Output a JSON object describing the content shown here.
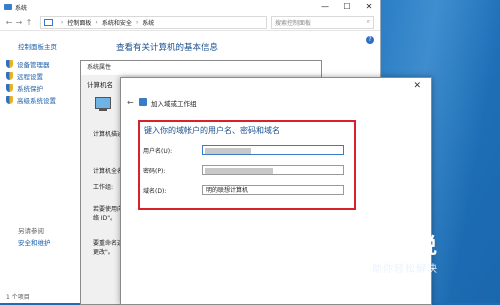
{
  "system_window": {
    "title": "系统",
    "controls": {
      "minimize": "—",
      "maximize": "☐",
      "close": "✕"
    },
    "breadcrumb": [
      "控制面板",
      "系统和安全",
      "系统"
    ],
    "search_placeholder": "搜索控制面板",
    "left_nav": {
      "home": "控制面板主页",
      "items": [
        "设备管理器",
        "远程设置",
        "系统保护",
        "高级系统设置"
      ],
      "see_also": "另请参阅",
      "security": "安全和维护"
    },
    "heading": "查看有关计算机的基本信息",
    "status": "1 个项目"
  },
  "properties_window": {
    "title": "系统属性",
    "tab": "计算机名",
    "labels": [
      "计算机描述",
      "计算机全名",
      "工作组:",
      "若要使用向导",
      "络 ID\"。",
      "要重命名这台",
      "更改\"。"
    ]
  },
  "dialog": {
    "title": "加入域或工作组",
    "close": "✕",
    "back": "←",
    "prompt": "键入你的域帐户的用户名、密码和域名",
    "fields": [
      {
        "label": "用户名(U):",
        "value": ""
      },
      {
        "label": "密码(P):",
        "value": ""
      },
      {
        "label": "域名(D):",
        "value": "明的联想计算机"
      }
    ]
  },
  "watermark": {
    "main": "百科全说",
    "sub": "助你轻松解决"
  },
  "colors": {
    "highlight_border": "#d8212b",
    "link": "#1a5ea8",
    "desktop": "#1c6fb4"
  }
}
